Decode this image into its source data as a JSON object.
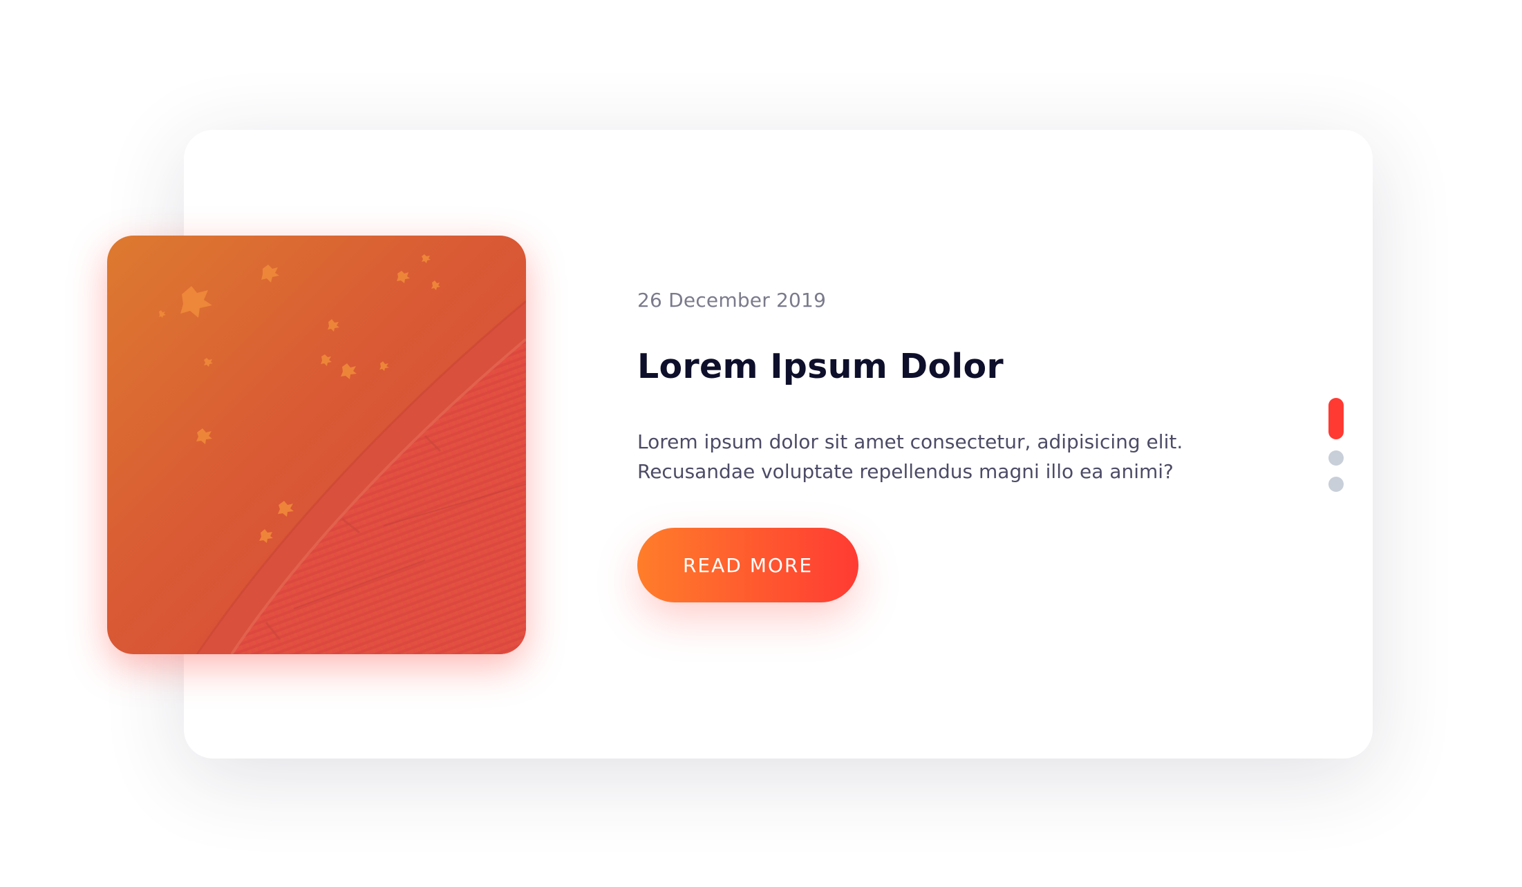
{
  "card": {
    "date": "26 December 2019",
    "title": "Lorem Ipsum Dolor",
    "description": "Lorem ipsum dolor sit amet consectetur, adipisicing elit. Recusandae voluptate repellendus magni illo ea animi?",
    "button_label": "READ MORE"
  },
  "pager": {
    "count": 3,
    "active_index": 0
  },
  "colors": {
    "accent": "#ff3a33",
    "accent_gradient_start": "#ff7d2a",
    "accent_gradient_end": "#ff3b33",
    "title": "#0e0f2b",
    "date": "#7a7a8c",
    "body": "#4c4b66",
    "inactive_dot": "#c9cfd8"
  },
  "icons": {
    "image": "autumn-pavement-photo"
  }
}
